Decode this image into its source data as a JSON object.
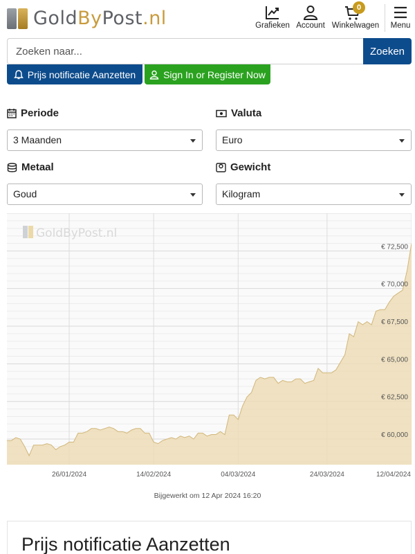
{
  "header": {
    "logo": {
      "part1": "Gold",
      "part2": "By",
      "part3": "Post",
      "part4": ".nl"
    },
    "nav": [
      {
        "label": "Grafieken",
        "icon": "chart-icon"
      },
      {
        "label": "Account",
        "icon": "user-icon"
      },
      {
        "label": "Winkelwagen",
        "icon": "cart-icon",
        "badge": "0"
      },
      {
        "label": "Menu",
        "icon": "hamburger-icon"
      }
    ]
  },
  "search": {
    "placeholder": "Zoeken naar...",
    "value": "",
    "button_label": "Zoeken"
  },
  "actions": {
    "notify_label": "Prijs notificatie Aanzetten",
    "signin_label": "Sign In or Register Now"
  },
  "filters": {
    "period": {
      "label": "Periode",
      "value": "3 Maanden"
    },
    "currency": {
      "label": "Valuta",
      "value": "Euro"
    },
    "metal": {
      "label": "Metaal",
      "value": "Goud"
    },
    "weight": {
      "label": "Gewicht",
      "value": "Kilogram"
    }
  },
  "chart_data": {
    "type": "area",
    "watermark": "GoldByPost.nl",
    "x_tick_labels": [
      "26/01/2024",
      "14/02/2024",
      "04/03/2024",
      "24/03/2024",
      "12/04/2024"
    ],
    "y_tick_labels": [
      "€ 60,000",
      "€ 62,500",
      "€ 65,000",
      "€ 67,500",
      "€ 70,000",
      "€ 72,500"
    ],
    "y_ticks": [
      60000,
      62500,
      65000,
      67500,
      70000,
      72500
    ],
    "ylim": [
      58300,
      75000
    ],
    "x_range_days": [
      0,
      91
    ],
    "x_tick_days": [
      14,
      33,
      52,
      72,
      91
    ],
    "grid": true,
    "fill_color": "#ecdcb6",
    "line_color": "#d2b67a",
    "points": [
      [
        0,
        59900
      ],
      [
        1,
        59900
      ],
      [
        2,
        60100
      ],
      [
        3,
        60000
      ],
      [
        4,
        59500
      ],
      [
        5,
        58900
      ],
      [
        6,
        59600
      ],
      [
        7,
        59600
      ],
      [
        8,
        59600
      ],
      [
        9,
        59700
      ],
      [
        10,
        59600
      ],
      [
        11,
        59300
      ],
      [
        12,
        59500
      ],
      [
        13,
        59600
      ],
      [
        14,
        59800
      ],
      [
        15,
        59800
      ],
      [
        16,
        60400
      ],
      [
        17,
        60400
      ],
      [
        18,
        60500
      ],
      [
        19,
        60700
      ],
      [
        20,
        60700
      ],
      [
        21,
        60600
      ],
      [
        22,
        60700
      ],
      [
        23,
        60800
      ],
      [
        24,
        60700
      ],
      [
        25,
        60500
      ],
      [
        26,
        60500
      ],
      [
        27,
        60400
      ],
      [
        28,
        60600
      ],
      [
        29,
        60700
      ],
      [
        30,
        60700
      ],
      [
        31,
        60400
      ],
      [
        32,
        60400
      ],
      [
        33,
        59800
      ],
      [
        34,
        59700
      ],
      [
        35,
        59900
      ],
      [
        36,
        60000
      ],
      [
        37,
        60100
      ],
      [
        38,
        60000
      ],
      [
        39,
        60200
      ],
      [
        40,
        60100
      ],
      [
        41,
        60200
      ],
      [
        42,
        60000
      ],
      [
        43,
        60400
      ],
      [
        44,
        60400
      ],
      [
        45,
        60200
      ],
      [
        46,
        60300
      ],
      [
        47,
        60300
      ],
      [
        48,
        60500
      ],
      [
        49,
        60300
      ],
      [
        50,
        61600
      ],
      [
        51,
        61600
      ],
      [
        52,
        61300
      ],
      [
        53,
        62200
      ],
      [
        54,
        62800
      ],
      [
        55,
        63100
      ],
      [
        56,
        63900
      ],
      [
        57,
        64100
      ],
      [
        58,
        64000
      ],
      [
        59,
        64100
      ],
      [
        60,
        64100
      ],
      [
        61,
        63700
      ],
      [
        62,
        63900
      ],
      [
        63,
        63800
      ],
      [
        64,
        63800
      ],
      [
        65,
        64000
      ],
      [
        66,
        64000
      ],
      [
        67,
        63700
      ],
      [
        68,
        63800
      ],
      [
        69,
        63900
      ],
      [
        70,
        64700
      ],
      [
        71,
        64400
      ],
      [
        72,
        64400
      ],
      [
        73,
        64400
      ],
      [
        74,
        64600
      ],
      [
        75,
        65100
      ],
      [
        76,
        65600
      ],
      [
        77,
        67000
      ],
      [
        78,
        66800
      ],
      [
        79,
        67800
      ],
      [
        80,
        67600
      ],
      [
        81,
        67800
      ],
      [
        82,
        67600
      ],
      [
        83,
        68500
      ],
      [
        84,
        68600
      ],
      [
        85,
        68600
      ],
      [
        86,
        69100
      ],
      [
        87,
        69500
      ],
      [
        88,
        69700
      ],
      [
        89,
        69900
      ],
      [
        90,
        71200
      ],
      [
        91,
        73000
      ]
    ]
  },
  "updated_text": "Bijgewerkt om 12 Apr 2024 16:20",
  "card": {
    "title": "Prijs notificatie Aanzetten"
  }
}
